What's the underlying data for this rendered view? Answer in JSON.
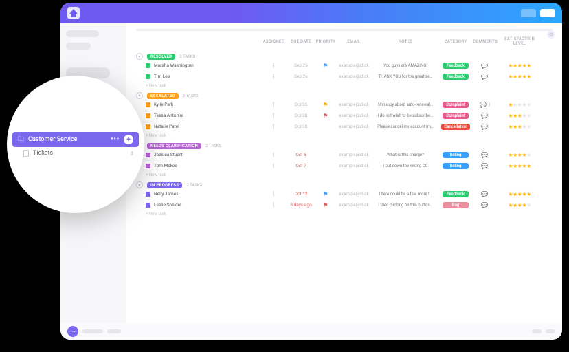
{
  "columns": [
    "",
    "ASSIGNEE",
    "DUE DATE",
    "PRIORITY",
    "EMAIL",
    "NOTES",
    "CATEGORY",
    "COMMENTS",
    "SATISFACTION LEVEL"
  ],
  "newTask": "+ New task",
  "emailText": "example@click",
  "zoom": {
    "folder": "Customer Service",
    "list": "Tickets",
    "count": "8"
  },
  "groups": [
    {
      "status": "RESOLVED",
      "color": "#2ecc71",
      "count": "2 TASKS",
      "rows": [
        {
          "sq": "#2ecc71",
          "name": "Marsha Washington",
          "due": "Sep 25",
          "dueClass": "date-normal",
          "flag": "#3aa0ff",
          "notes": "You guys are AMAZING!",
          "cat": "Feedback",
          "catColor": "#2ecc71",
          "stars": 5,
          "comments": ""
        },
        {
          "sq": "#2ecc71",
          "name": "Tim Lee",
          "due": "Sep 26",
          "dueClass": "date-normal",
          "flag": "",
          "notes": "THANK YOU for the great se…",
          "cat": "Feedback",
          "catColor": "#2ecc71",
          "stars": 5,
          "comments": ""
        }
      ]
    },
    {
      "status": "ESCALATED",
      "color": "#ff9f1a",
      "count": "3 TASKS",
      "rows": [
        {
          "sq": "#ff9f1a",
          "name": "Kylie Park",
          "due": "Oct 26",
          "dueClass": "date-normal",
          "flag": "#ffb400",
          "notes": "Unhappy about auto-renewal…",
          "cat": "Complaint",
          "catColor": "#eb5a8f",
          "stars": 1,
          "comments": "1"
        },
        {
          "sq": "#ff9f1a",
          "name": "Tessa Antonini",
          "due": "Oct 28",
          "dueClass": "date-normal",
          "flag": "#e05a5a",
          "notes": "I do not wish to be subscribe…",
          "cat": "Complaint",
          "catColor": "#eb5a8f",
          "stars": 3,
          "comments": ""
        },
        {
          "sq": "#ff9f1a",
          "name": "Natalie Patel",
          "due": "Oct 30",
          "dueClass": "date-normal",
          "flag": "",
          "notes": "Please cancel my account im…",
          "cat": "Cancellation",
          "catColor": "#e74c3c",
          "stars": 3,
          "comments": ""
        }
      ]
    },
    {
      "status": "NEEDS CLARIFICATION",
      "color": "#b866d6",
      "count": "2 TASKS",
      "rows": [
        {
          "sq": "#b866d6",
          "name": "Jessica Stuart",
          "due": "Oct 6",
          "dueClass": "date-warn",
          "flag": "",
          "notes": "What is this charge?",
          "cat": "Billing",
          "catColor": "#3aa0ff",
          "stars": 4,
          "comments": ""
        },
        {
          "sq": "#b866d6",
          "name": "Tom Mckee",
          "due": "Oct 7",
          "dueClass": "date-warn",
          "flag": "",
          "notes": "I put down the wrong CC",
          "cat": "Billing",
          "catColor": "#3aa0ff",
          "stars": 5,
          "comments": ""
        }
      ]
    },
    {
      "status": "IN PROGRESS",
      "color": "#7b68ee",
      "count": "2 TASKS",
      "rows": [
        {
          "sq": "#7b68ee",
          "name": "Nelly James",
          "due": "Oct 12",
          "dueClass": "date-warn",
          "flag": "#3aa0ff",
          "notes": "There could be a few more t…",
          "cat": "Feedback",
          "catColor": "#2ecc71",
          "stars": 5,
          "comments": ""
        },
        {
          "sq": "#7b68ee",
          "name": "Leslie Sneider",
          "due": "8 days ago",
          "dueClass": "date-warn",
          "flag": "#e05a5a",
          "notes": "I tried clicking on this button…",
          "cat": "Bug",
          "catColor": "#eb8f9f",
          "stars": 4,
          "comments": ""
        }
      ]
    }
  ]
}
